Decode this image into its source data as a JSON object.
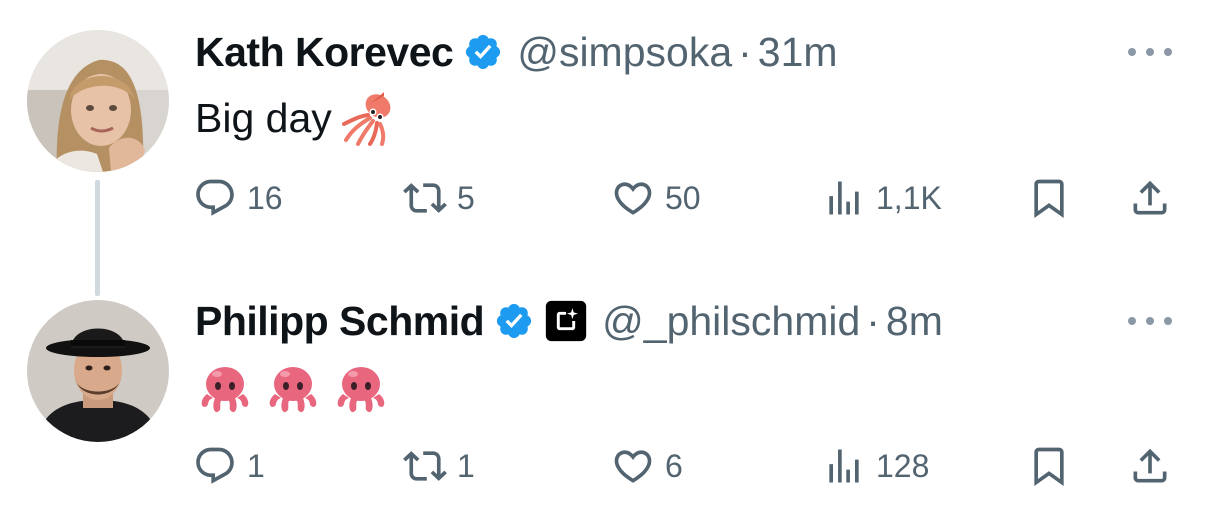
{
  "tweets": [
    {
      "author_name": "Kath Korevec",
      "handle": "@simpsoka",
      "separator": "·",
      "time": "31m",
      "text": "Big day",
      "text_emoji": "squid-emoji",
      "verified": true,
      "avatar": "avatar-woman-photo",
      "stats": {
        "replies": "16",
        "reposts": "5",
        "likes": "50",
        "views": "1,1K"
      }
    },
    {
      "author_name": "Philipp Schmid",
      "handle": "@_philschmid",
      "separator": "·",
      "time": "8m",
      "text_emojis": [
        "octopus-emoji",
        "octopus-emoji",
        "octopus-emoji"
      ],
      "verified": true,
      "affiliate_badge": "affiliate-logo-icon",
      "avatar": "avatar-man-hat-photo",
      "stats": {
        "replies": "1",
        "reposts": "1",
        "likes": "6",
        "views": "128"
      }
    }
  ],
  "colors": {
    "text": "#0f1419",
    "secondary": "#536471",
    "verified_blue": "#1d9bf0",
    "thread_line": "#cfd9de"
  }
}
